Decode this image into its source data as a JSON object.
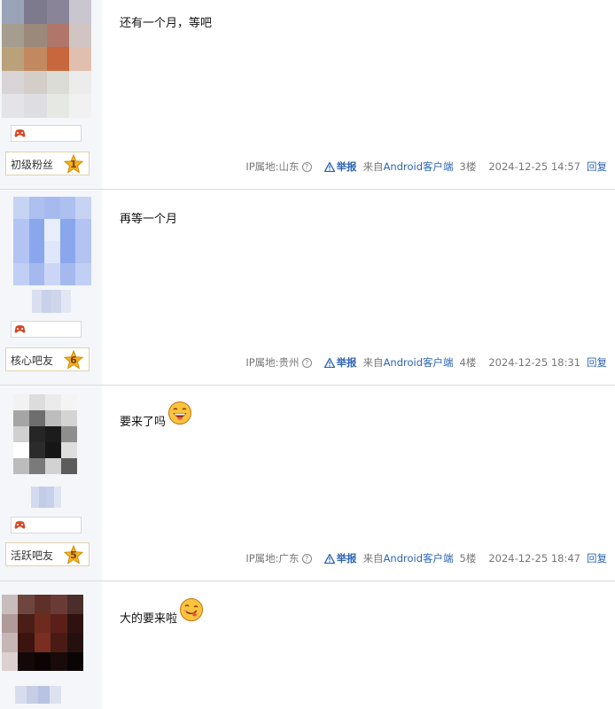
{
  "posts": [
    {
      "text": "还有一个月，等吧",
      "level_name": "初级粉丝",
      "level": "1",
      "ip_label": "IP属地:山东",
      "report": "举报",
      "source_prefix": "来自",
      "source_client": "Android客户端",
      "floor": "3楼",
      "time": "2024-12-25 14:57",
      "reply": "回复",
      "emoji": ""
    },
    {
      "text": "再等一个月",
      "level_name": "核心吧友",
      "level": "6",
      "ip_label": "IP属地:贵州",
      "report": "举报",
      "source_prefix": "来自",
      "source_client": "Android客户端",
      "floor": "4楼",
      "time": "2024-12-25 18:31",
      "reply": "回复",
      "emoji": ""
    },
    {
      "text": "要来了吗",
      "level_name": "活跃吧友",
      "level": "5",
      "ip_label": "IP属地:广东",
      "report": "举报",
      "source_prefix": "来自",
      "source_client": "Android客户端",
      "floor": "5楼",
      "time": "2024-12-25 18:47",
      "reply": "回复",
      "emoji": "laughing-face-emoji"
    },
    {
      "text": "大的要来啦",
      "emoji": "tongue-out-face-emoji"
    }
  ],
  "colors": {
    "link": "#2d64b3",
    "sidebar_bg": "#f4f6f9",
    "meta_text": "#777777"
  }
}
